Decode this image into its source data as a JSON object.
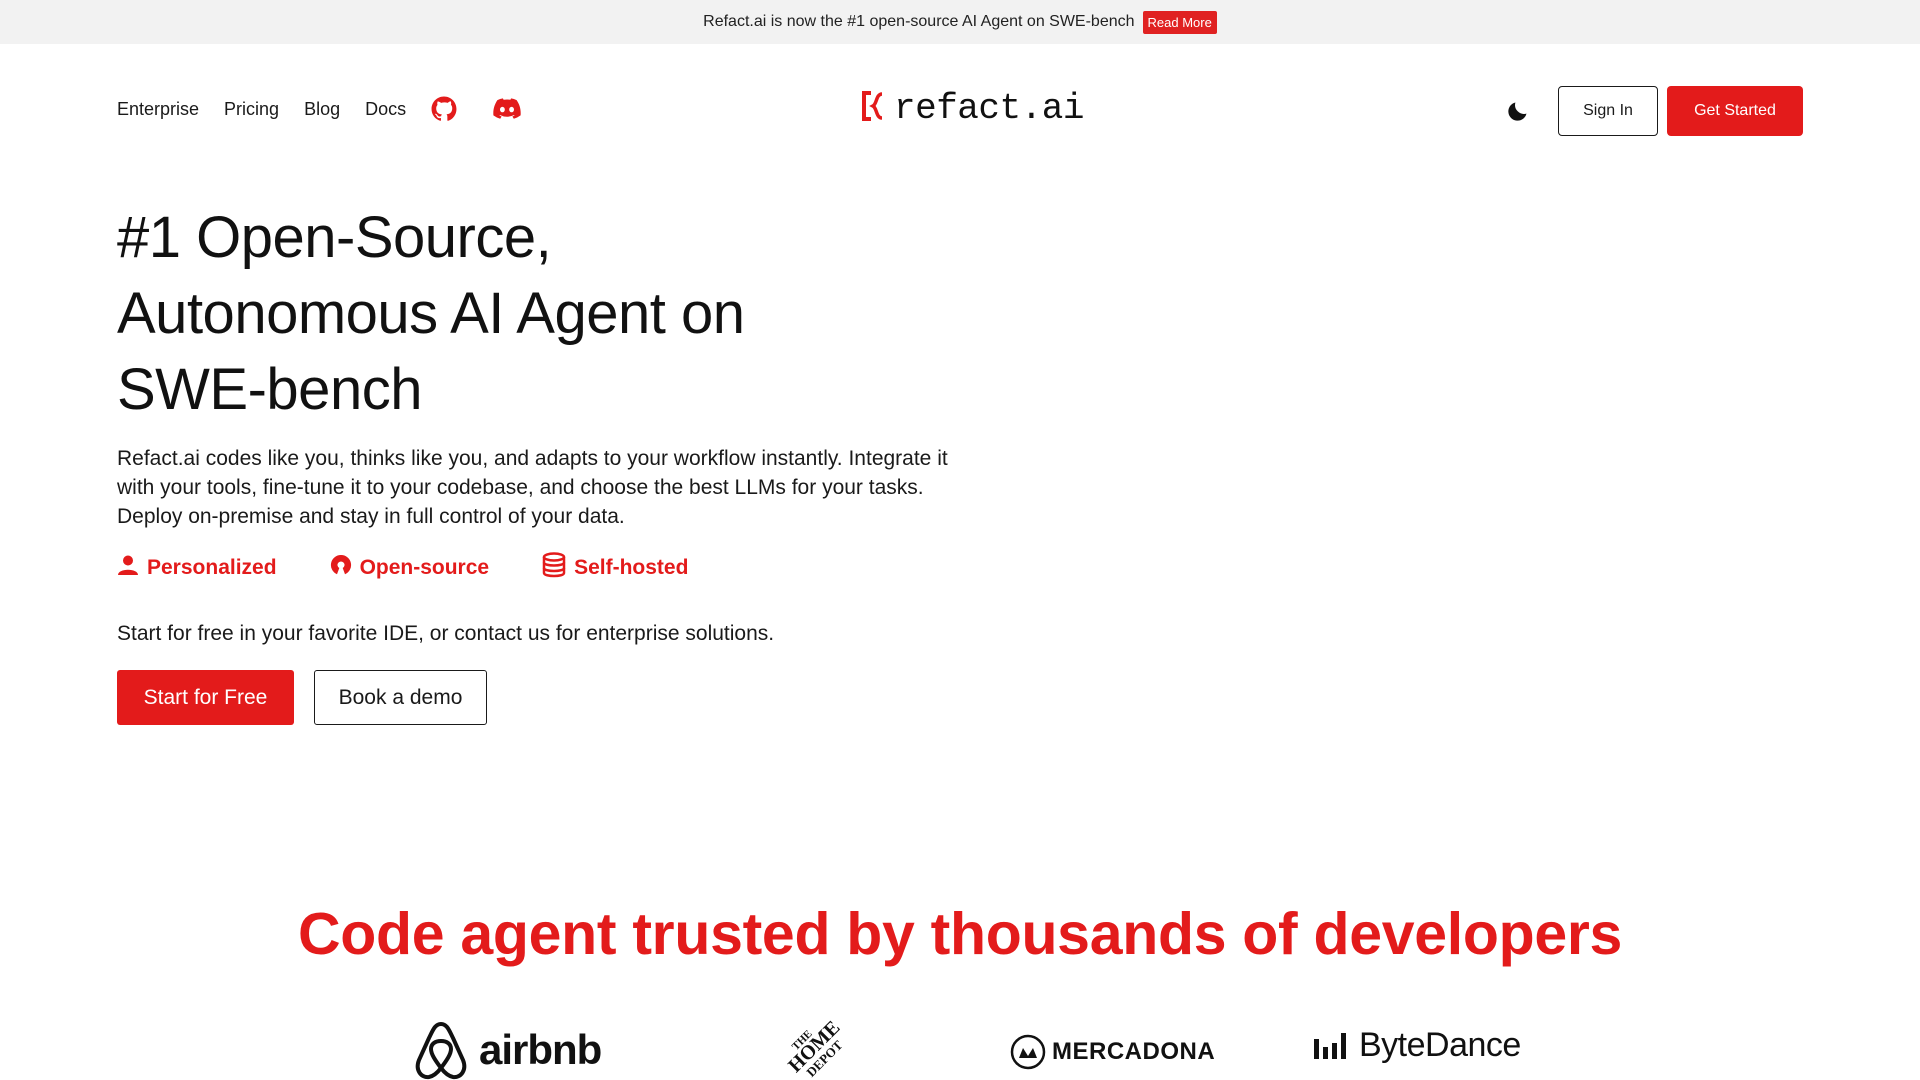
{
  "announcement": {
    "text": "Refact.ai is now the #1 open-source AI Agent on SWE-bench",
    "link_label": "Read More"
  },
  "nav": {
    "links": [
      "Enterprise",
      "Pricing",
      "Blog",
      "Docs"
    ],
    "icons": [
      "github-icon",
      "discord-icon"
    ]
  },
  "logo": {
    "text": "refact.ai"
  },
  "header_actions": {
    "theme_icon": "moon-icon",
    "sign_in": "Sign In",
    "get_started": "Get Started"
  },
  "hero": {
    "title_lines": [
      "#1 Open-Source,",
      "Autonomous AI Agent on",
      "SWE-bench"
    ],
    "description": "Refact.ai codes like you, thinks like you, and adapts to your workflow instantly. Integrate it with your tools, fine-tune it to your codebase, and choose the best LLMs for your tasks. Deploy on-premise and stay in full control of your data.",
    "features": [
      {
        "label": "Personalized",
        "icon": "user-icon"
      },
      {
        "label": "Open-source",
        "icon": "open-source-icon"
      },
      {
        "label": "Self-hosted",
        "icon": "database-icon"
      }
    ],
    "cta_text": "Start for free in your favorite IDE, or contact us for enterprise solutions.",
    "primary_button": "Start for Free",
    "secondary_button": "Book a demo"
  },
  "trusted": {
    "heading": "Code agent trusted by thousands of developers",
    "brands": [
      {
        "name": "airbnb",
        "icon": "airbnb-logo-icon"
      },
      {
        "name": "THE HOME DEPOT",
        "icon": "home-depot-logo-icon"
      },
      {
        "name": "MERCADONA",
        "icon": "mercadona-logo-icon"
      },
      {
        "name": "ByteDance",
        "icon": "bytedance-logo-icon"
      }
    ]
  },
  "colors": {
    "accent": "#e31b1b",
    "announcement_bg": "#f2f2f2",
    "text": "#111111"
  }
}
